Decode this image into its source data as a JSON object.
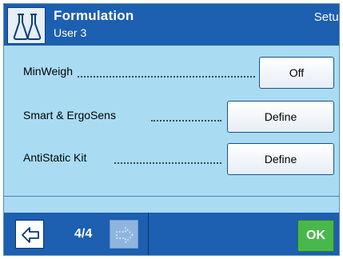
{
  "header": {
    "title": "Formulation",
    "subtitle": "User 3",
    "setup_label": "Setup"
  },
  "rows": [
    {
      "label": "MinWeigh",
      "button": "Off"
    },
    {
      "label": "Smart & ErgoSens",
      "button": "Define"
    },
    {
      "label": "AntiStatic Kit",
      "button": "Define"
    }
  ],
  "footer": {
    "page_indicator": "4/4",
    "ok_label": "OK"
  },
  "colors": {
    "header_blue": "#1d5fb0",
    "content_bg": "#a9dcf3",
    "ok_green": "#49b84c"
  }
}
